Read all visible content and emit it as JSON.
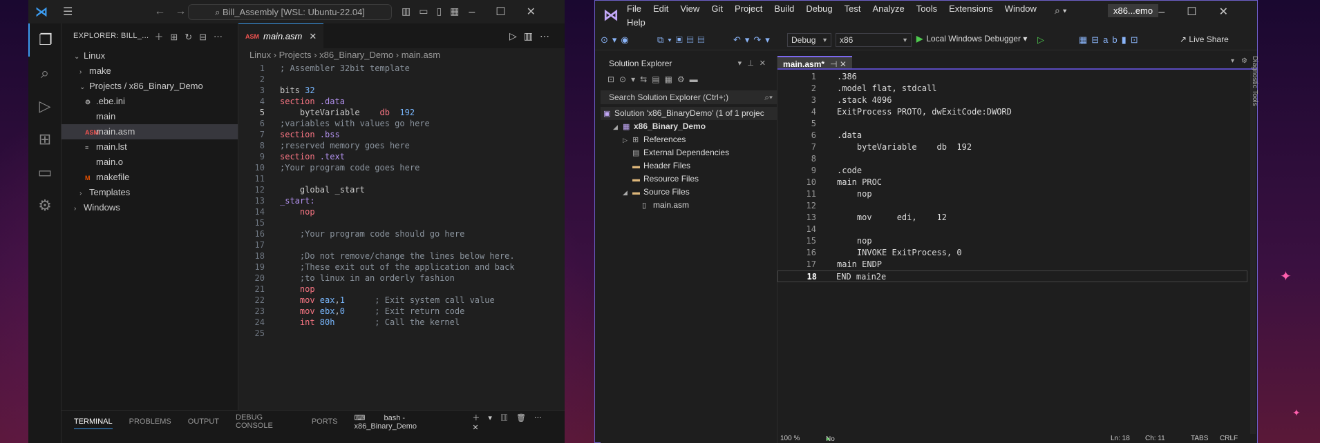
{
  "vscode": {
    "search_text": "Bill_Assembly [WSL: Ubuntu-22.04]",
    "explorer_title": "EXPLORER: BILL_...",
    "tree": [
      {
        "label": "Linux",
        "level": 0,
        "chevron": "v"
      },
      {
        "label": "make",
        "level": 1,
        "chevron": ">"
      },
      {
        "label": "Projects / x86_Binary_Demo",
        "level": 1,
        "chevron": "v"
      },
      {
        "label": ".ebe.ini",
        "level": 2,
        "icon": "gear"
      },
      {
        "label": "main",
        "level": 2,
        "icon": "none"
      },
      {
        "label": "main.asm",
        "level": 2,
        "icon": "asm",
        "selected": true
      },
      {
        "label": "main.lst",
        "level": 2,
        "icon": "lines"
      },
      {
        "label": "main.o",
        "level": 2,
        "icon": "none"
      },
      {
        "label": "makefile",
        "level": 2,
        "icon": "make"
      },
      {
        "label": "Templates",
        "level": 1,
        "chevron": ">"
      },
      {
        "label": "Windows",
        "level": 0,
        "chevron": ">"
      }
    ],
    "tab_label": "main.asm",
    "breadcrumb": [
      "Linux",
      "Projects",
      "x86_Binary_Demo",
      "main.asm"
    ],
    "active_line": 5,
    "code": [
      [
        [
          "cm",
          "; Assembler 32bit template"
        ]
      ],
      [],
      [
        [
          "",
          "bits "
        ],
        [
          "n",
          "32"
        ]
      ],
      [
        [
          "k",
          "section"
        ],
        [
          "",
          ""
        ],
        [
          "lb",
          " .data"
        ]
      ],
      [
        [
          "",
          "    byteVariable    "
        ],
        [
          "k",
          "db"
        ],
        [
          "",
          "  "
        ],
        [
          "n",
          "192"
        ]
      ],
      [
        [
          "cm",
          ";variables with values go here"
        ]
      ],
      [
        [
          "k",
          "section"
        ],
        [
          "lb",
          " .bss"
        ]
      ],
      [
        [
          "cm",
          ";reserved memory goes here"
        ]
      ],
      [
        [
          "k",
          "section"
        ],
        [
          "lb",
          " .text"
        ]
      ],
      [
        [
          "cm",
          ";Your program code goes here"
        ]
      ],
      [],
      [
        [
          "",
          "    global _start"
        ]
      ],
      [
        [
          "lb",
          "_start:"
        ]
      ],
      [
        [
          "k",
          "    nop"
        ]
      ],
      [],
      [
        [
          "cm",
          "    ;Your program code should go here"
        ]
      ],
      [],
      [
        [
          "cm",
          "    ;Do not remove/change the lines below here."
        ]
      ],
      [
        [
          "cm",
          "    ;These exit out of the application and back"
        ]
      ],
      [
        [
          "cm",
          "    ;to linux in an orderly fashion"
        ]
      ],
      [
        [
          "k",
          "    nop"
        ]
      ],
      [
        [
          "k",
          "    mov "
        ],
        [
          "n",
          "eax"
        ],
        [
          "",
          ","
        ],
        [
          "n",
          "1"
        ],
        [
          "cm",
          "      ; Exit system call value"
        ]
      ],
      [
        [
          "k",
          "    mov "
        ],
        [
          "n",
          "ebx"
        ],
        [
          "",
          ","
        ],
        [
          "n",
          "0"
        ],
        [
          "cm",
          "      ; Exit return code"
        ]
      ],
      [
        [
          "k",
          "    int "
        ],
        [
          "n",
          "80h"
        ],
        [
          "cm",
          "        ; Call the kernel"
        ]
      ],
      []
    ],
    "panel_tabs": [
      "TERMINAL",
      "PROBLEMS",
      "OUTPUT",
      "DEBUG CONSOLE",
      "PORTS"
    ],
    "terminal_label": "bash - x86_Binary_Demo"
  },
  "vs": {
    "menu": [
      "File",
      "Edit",
      "View",
      "Git",
      "Project",
      "Build",
      "Debug",
      "Test",
      "Analyze",
      "Tools",
      "Extensions",
      "Window"
    ],
    "help": "Help",
    "project_badge": "x86...emo",
    "config": "Debug",
    "platform": "x86",
    "run_label": "Local Windows Debugger",
    "live_share": "Live Share",
    "solution_explorer_title": "Solution Explorer",
    "search_placeholder": "Search Solution Explorer (Ctrl+;)",
    "nodes": [
      {
        "label": "Solution 'x86_BinaryDemo' (1 of 1 projec",
        "level": 0,
        "icon": "sol"
      },
      {
        "label": "x86_Binary_Demo",
        "level": 1,
        "icon": "proj",
        "bold": true,
        "expand": "◢"
      },
      {
        "label": "References",
        "level": 2,
        "icon": "ref",
        "expand": "▷"
      },
      {
        "label": "External Dependencies",
        "level": 2,
        "icon": "ext",
        "expand": ""
      },
      {
        "label": "Header Files",
        "level": 2,
        "icon": "folder",
        "expand": ""
      },
      {
        "label": "Resource Files",
        "level": 2,
        "icon": "folder",
        "expand": ""
      },
      {
        "label": "Source Files",
        "level": 2,
        "icon": "folder",
        "expand": "◢"
      },
      {
        "label": "main.asm",
        "level": 3,
        "icon": "file",
        "expand": ""
      }
    ],
    "tab_label": "main.asm*",
    "active_line": 18,
    "code": [
      ".386",
      ".model flat, stdcall",
      ".stack 4096",
      "ExitProcess PROTO, dwExitCode:DWORD",
      "",
      ".data",
      "    byteVariable    db  192",
      "",
      ".code",
      "main PROC",
      "    nop",
      "",
      "    mov     edi,    12",
      "",
      "    nop",
      "    INVOKE ExitProcess, 0",
      "main ENDP",
      "END main2e"
    ],
    "status": {
      "zoom": "100 %",
      "issues": "No issues found",
      "ln": "Ln: 18",
      "ch": "Ch: 11",
      "tabs": "TABS",
      "eol": "CRLF"
    },
    "diag_tools": "Diagnostic Tools"
  }
}
